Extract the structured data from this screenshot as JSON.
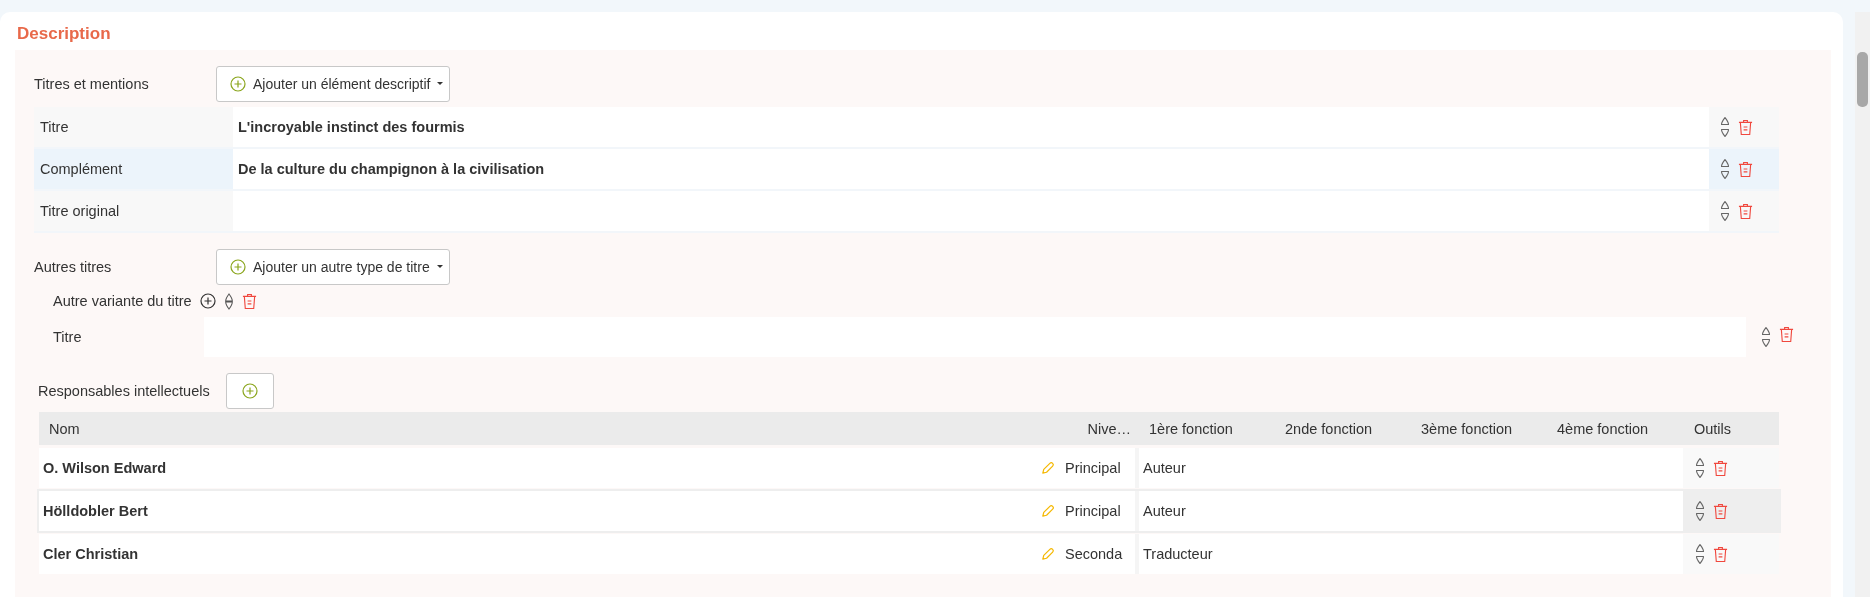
{
  "section_title": "Description",
  "titles": {
    "label": "Titres et mentions",
    "add_button": "Ajouter un élément descriptif",
    "rows": [
      {
        "label": "Titre",
        "value": "L'incroyable instinct des fourmis",
        "selected": false
      },
      {
        "label": "Complément",
        "value": "De la culture du champignon à la civilisation",
        "selected": true
      },
      {
        "label": "Titre original",
        "selected": false
      }
    ]
  },
  "other_titles": {
    "label": "Autres titres",
    "add_button": "Ajouter un autre type de titre",
    "groups": [
      {
        "label": "Autre variante du titre",
        "fields": [
          {
            "label": "Titre"
          }
        ]
      }
    ]
  },
  "contributors": {
    "label": "Responsables intellectuels",
    "columns": [
      "Nom",
      "Nive…",
      "1ère fonction",
      "2nde fonction",
      "3ème fonction",
      "4ème fonction",
      "Outils"
    ],
    "rows": [
      {
        "name": "O. Wilson Edward",
        "level": "Principal",
        "functions": [
          "Auteur"
        ],
        "selected": false
      },
      {
        "name": "Hölldobler Bert",
        "level": "Principal",
        "functions": [
          "Auteur"
        ],
        "selected": true
      },
      {
        "name": "Cler Christian",
        "level": "Seconda",
        "functions": [
          "Traducteur"
        ],
        "selected": false
      }
    ]
  }
}
